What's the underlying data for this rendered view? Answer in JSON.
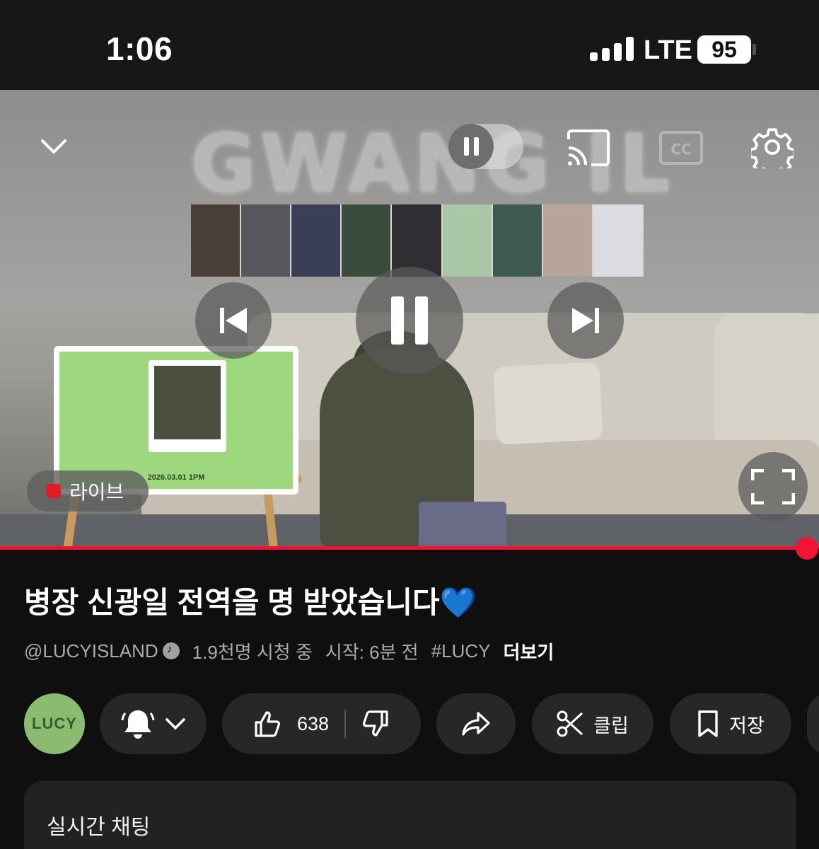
{
  "status_bar": {
    "time": "1:06",
    "network": "LTE",
    "battery": "95"
  },
  "player": {
    "live_label": "라이브",
    "tv_date": "2026.03.01 1PM",
    "wall_text": "GWANG IL",
    "accent_color": "#f31434"
  },
  "video": {
    "title": "병장 신광일 전역을 명 받았습니다💙",
    "channel": "@LUCYISLAND",
    "viewers": "1.9천명 시청 중",
    "started": "시작: 6분 전",
    "hashtag": "#LUCY",
    "more": "더보기"
  },
  "actions": {
    "avatar_text": "LUCY",
    "likes": "638",
    "clip_label": "클립",
    "save_label": "저장"
  },
  "chat": {
    "title": "실시간 채팅"
  },
  "icons": [
    "chevron-down-icon",
    "pause-toggle-icon",
    "cast-icon",
    "captions-icon",
    "gear-icon",
    "previous-icon",
    "pause-icon",
    "next-icon",
    "fullscreen-icon",
    "bell-icon",
    "thumbs-up-icon",
    "thumbs-down-icon",
    "share-icon",
    "scissors-icon",
    "bookmark-icon",
    "verified-icon"
  ]
}
